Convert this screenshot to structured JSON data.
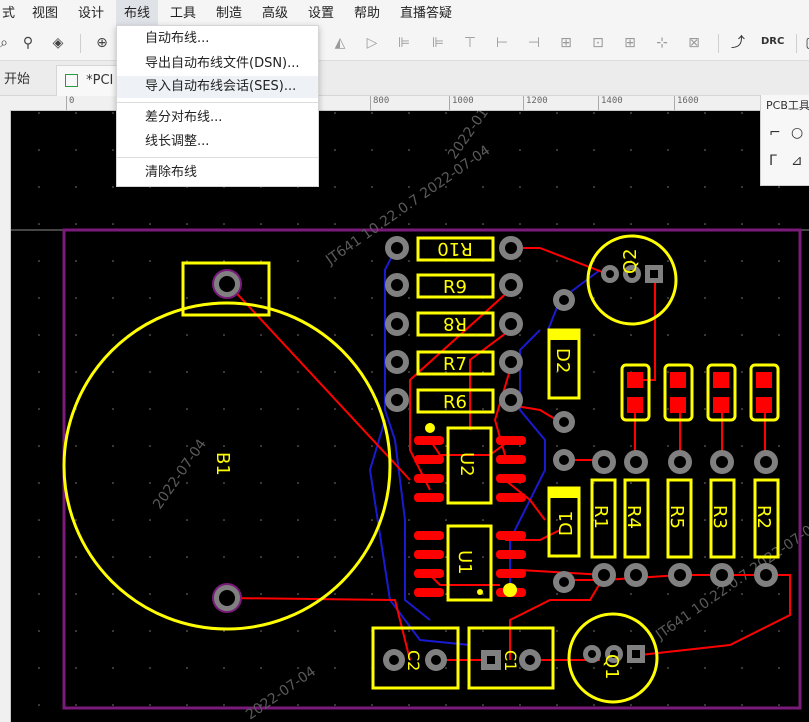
{
  "menubar": {
    "items": [
      "式",
      "视图",
      "设计",
      "布线",
      "工具",
      "制造",
      "高级",
      "设置",
      "帮助",
      "直播答疑"
    ],
    "active": "布线"
  },
  "routing_menu": {
    "items": [
      "自动布线...",
      "导出自动布线文件(DSN)...",
      "导入自动布线会话(SES)...",
      "差分对布线...",
      "线长调整...",
      "清除布线"
    ]
  },
  "toolbar": {
    "drc_label": "DRC"
  },
  "tabs": {
    "start": "开始",
    "pcb": "*PCI"
  },
  "ruler": {
    "ticks": [
      "0",
      "800",
      "1000",
      "1200",
      "1400",
      "1600"
    ]
  },
  "side_panel": {
    "title": "PCB工具"
  },
  "pcb": {
    "components": [
      "B1",
      "R10",
      "R9",
      "R8",
      "R7",
      "R6",
      "U2",
      "U1",
      "D2",
      "D1",
      "R1",
      "R4",
      "R5",
      "R3",
      "R2",
      "Q1",
      "Q2",
      "C1",
      "C2"
    ],
    "silkscreen_text": [
      "JT641 10.22.0.7 2022-07-04",
      "2022-07-04",
      "JT641 10.22.0.7 2022-07-04",
      "2022-07-04",
      "2022-01"
    ],
    "colors": {
      "board_outline": "#7a1a7a",
      "silkscreen": "#ffff00",
      "top_copper": "#ff0000",
      "bottom_copper": "#1a1ad0",
      "pad": "#808080",
      "background": "#000000"
    }
  }
}
